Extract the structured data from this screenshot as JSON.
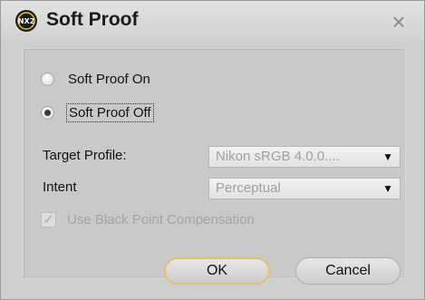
{
  "dialog": {
    "title": "Soft Proof",
    "app_logo": "NX2",
    "close_icon": "×"
  },
  "soft_proof": {
    "options": [
      {
        "label": "Soft Proof On",
        "checked": false
      },
      {
        "label": "Soft Proof Off",
        "checked": true
      }
    ]
  },
  "target_profile": {
    "label": "Target Profile:",
    "value": "Nikon sRGB 4.0.0....",
    "enabled": false
  },
  "intent": {
    "label": "Intent",
    "value": "Perceptual",
    "enabled": false
  },
  "black_point": {
    "label": "Use Black Point Compensation",
    "checked": true,
    "enabled": false,
    "check_glyph": "✓"
  },
  "buttons": {
    "ok": "OK",
    "cancel": "Cancel"
  },
  "icons": {
    "dropdown": "▼"
  },
  "colors": {
    "dialog_bg": "#cfcfcf",
    "ok_focus_ring": "#e3c26a",
    "disabled_text": "#a0a0a0"
  }
}
